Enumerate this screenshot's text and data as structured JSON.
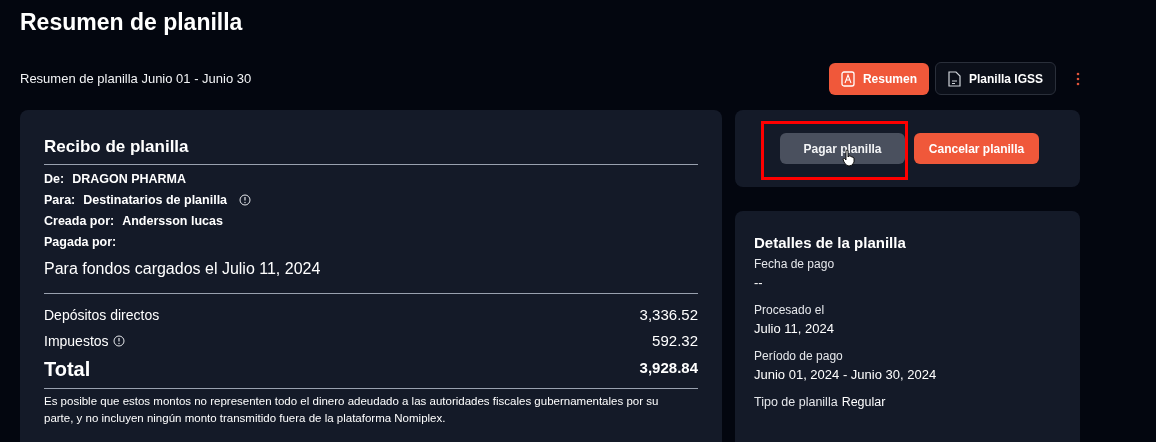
{
  "page_title": "Resumen de planilla",
  "subtitle": "Resumen de planilla Junio 01 - Junio 30",
  "toolbar": [
    {
      "label": "Resumen",
      "kind": "pdf",
      "primary": true
    },
    {
      "label": "Planilla IGSS",
      "kind": "file",
      "primary": false
    }
  ],
  "actions": [
    {
      "label": "Pagar planilla",
      "kind": "secondary",
      "highlighted": true,
      "hovered": true
    },
    {
      "label": "Cancelar planilla",
      "kind": "danger",
      "highlighted": false,
      "hovered": false
    }
  ],
  "receipt": {
    "title": "Recibo de planilla",
    "fields": [
      {
        "label": "De:",
        "value": "DRAGON PHARMA",
        "info": false
      },
      {
        "label": "Para:",
        "value": "Destinatarios de planilla",
        "info": true
      },
      {
        "label": "Creada por:",
        "value": "Andersson lucas",
        "info": false
      },
      {
        "label": "Pagada por:",
        "info": false
      }
    ],
    "funds_note": "Para fondos cargados el Julio 11, 2024",
    "lines": [
      {
        "label": "Depósitos directos",
        "amount": "3,336.52",
        "info": false
      },
      {
        "label": "Impuestos",
        "amount": "592.32",
        "info": true
      }
    ],
    "total": {
      "label": "Total",
      "amount": "3,928.84"
    },
    "disclaimer": "Es posible que estos montos no representen todo el dinero adeudado a las autoridades fiscales gubernamentales por su parte, y no incluyen ningún monto transmitido fuera de la plataforma Nomiplex."
  },
  "details": {
    "title": "Detalles de la planilla",
    "items": [
      {
        "label": "Fecha de pago",
        "value": "--"
      },
      {
        "label": "Procesado el",
        "value": "Julio 11, 2024"
      },
      {
        "label": "Período de pago",
        "value": "Junio 01, 2024 - Junio 30, 2024"
      }
    ],
    "type_label": "Tipo de planilla",
    "type_value": "Regular"
  }
}
